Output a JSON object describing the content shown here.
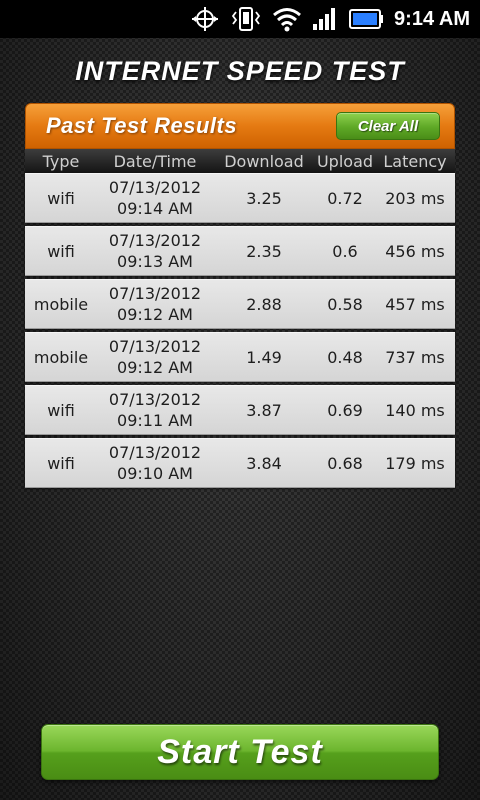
{
  "status_bar": {
    "time": "9:14 AM",
    "icons": [
      "gps-icon",
      "vibrate-icon",
      "wifi-icon",
      "signal-icon",
      "battery-icon"
    ]
  },
  "app": {
    "title": "INTERNET SPEED TEST"
  },
  "results": {
    "header_title": "Past Test Results",
    "clear_all_label": "Clear All",
    "columns": [
      "Type",
      "Date/Time",
      "Download",
      "Upload",
      "Latency"
    ],
    "rows": [
      {
        "type": "wifi",
        "date": "07/13/2012",
        "time": "09:14 AM",
        "download": "3.25",
        "upload": "0.72",
        "latency": "203 ms"
      },
      {
        "type": "wifi",
        "date": "07/13/2012",
        "time": "09:13 AM",
        "download": "2.35",
        "upload": "0.6",
        "latency": "456 ms"
      },
      {
        "type": "mobile",
        "date": "07/13/2012",
        "time": "09:12 AM",
        "download": "2.88",
        "upload": "0.58",
        "latency": "457 ms"
      },
      {
        "type": "mobile",
        "date": "07/13/2012",
        "time": "09:12 AM",
        "download": "1.49",
        "upload": "0.48",
        "latency": "737 ms"
      },
      {
        "type": "wifi",
        "date": "07/13/2012",
        "time": "09:11 AM",
        "download": "3.87",
        "upload": "0.69",
        "latency": "140 ms"
      },
      {
        "type": "wifi",
        "date": "07/13/2012",
        "time": "09:10 AM",
        "download": "3.84",
        "upload": "0.68",
        "latency": "179 ms"
      }
    ]
  },
  "start_button": {
    "label": "Start Test"
  },
  "colors": {
    "header_orange": "#e57a12",
    "button_green": "#6cb52e",
    "battery_blue": "#2a7fff"
  }
}
